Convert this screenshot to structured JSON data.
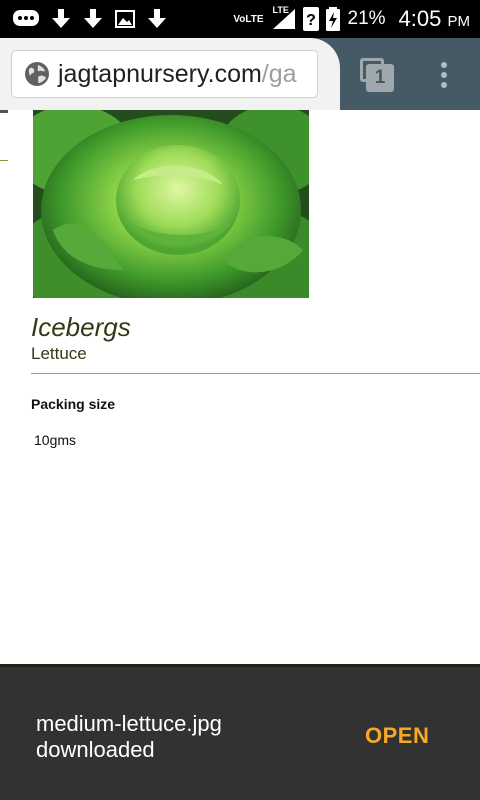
{
  "status_bar": {
    "network": "VoLTE",
    "lte": "LTE",
    "battery": "21%",
    "time": "4:05",
    "ampm": "PM"
  },
  "browser": {
    "url_host": "jagtapnursery.com",
    "url_path": "/ga",
    "tab_count": "1"
  },
  "product": {
    "image_alt": "lettuce head photo",
    "name": "Icebergs",
    "category": "Lettuce",
    "packing_label": "Packing size",
    "packing_value": "10gms"
  },
  "snackbar": {
    "message": "medium-lettuce.jpg downloaded",
    "action": "OPEN",
    "action_color": "#f9a825"
  }
}
